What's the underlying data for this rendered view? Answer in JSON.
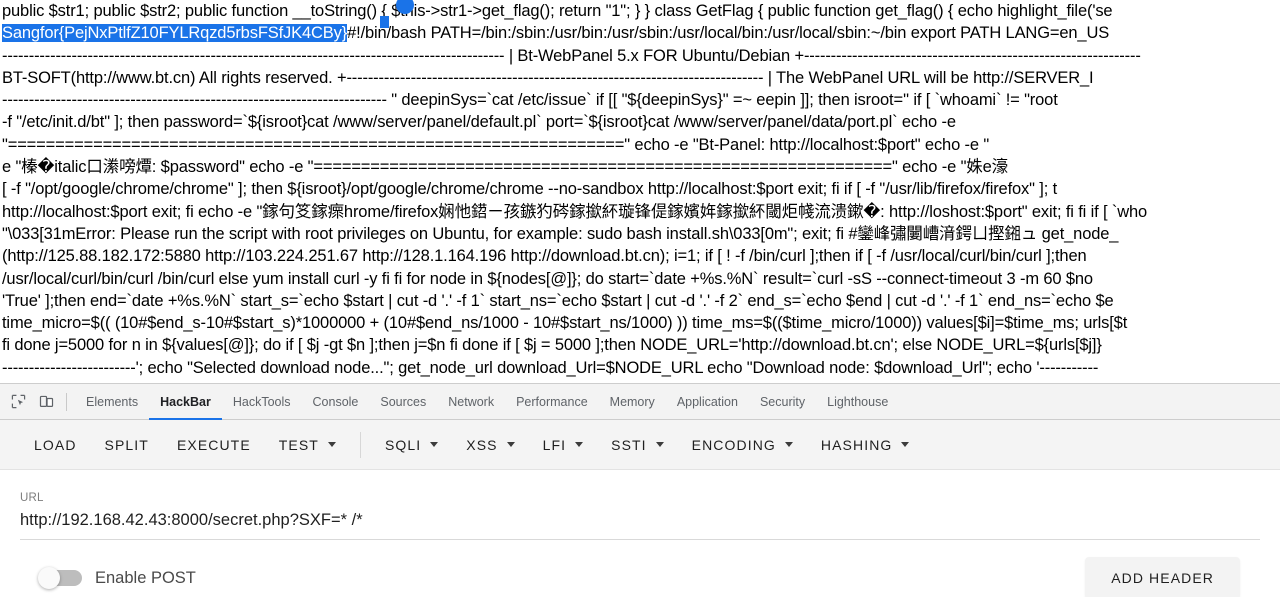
{
  "page": {
    "selected_text": "Sangfor{PejNxPtlfZ10FYLRqzd5rbsFSfJK4CBy}",
    "lines": [
      "public $str1; public $str2; public function __toString() { $this->str1->get_flag(); return \"1\"; } } class GetFlag { public function get_flag() { echo highlight_file('se",
      "#!/bin/bash PATH=/bin:/sbin:/usr/bin:/usr/sbin:/usr/local/bin:/usr/local/sbin:~/bin export PATH LANG=en_US",
      "---------------------------------------------------------------------------------------------- | Bt-WebPanel 5.x FOR Ubuntu/Debian +---------------------------------------------------------------",
      "BT-SOFT(http://www.bt.cn) All rights reserved. +------------------------------------------------------------------------------ | The WebPanel URL will be http://SERVER_I",
      "------------------------------------------------------------------------ \" deepinSys=`cat /etc/issue` if [[ \"${deepinSys}\" =~ eepin ]]; then isroot='' if [ `whoami` != \"root",
      "-f \"/etc/init.d/bt\" ]; then password=`${isroot}cat /www/server/panel/default.pl` port=`${isroot}cat /www/server/panel/data/port.pl` echo -e",
      "\"=================================================================\" echo -e \"Bt-Panel: http://localhost:$port\" echo -e \"",
      "e \"榛�italic口潫嗙燂: $password\" echo -e \"=============================================================\" echo -e \"姝e濠",
      "[ -f \"/opt/google/chrome/chrome\" ]; then ${isroot}/opt/google/chrome/chrome --no-sandbox http://localhost:$port exit; fi if [ -f \"/usr/lib/firefox/firefox\" ]; t",
      "http://localhost:$port exit; fi echo -e \"鎵句笅鎵瘝hrome/firefox娴忚鍣ㄧ孩鏃犳硶鎵撳紑璇锋偍鎵嬪姩鎵撳紑閾炬帴流溃鏉�: http://loshost:$port\" exit; fi fi if [ `who",
      "\"\\033[31mError: Please run the script with root privileges on Ubuntu, for example: sudo bash install.sh\\033[0m\"; exit; fi #鑾峰彇闄嶆湇鍔ㄩ摼鎺ュ get_node_",
      "(http://125.88.182.172:5880 http://103.224.251.67 http://128.1.164.196 http://download.bt.cn); i=1; if [ ! -f /bin/curl ];then if [ -f /usr/local/curl/bin/curl ];then",
      "/usr/local/curl/bin/curl /bin/curl else yum install curl -y fi fi for node in ${nodes[@]}; do start=`date +%s.%N` result=`curl -sS --connect-timeout 3 -m 60 $no",
      "'True' ];then end=`date +%s.%N` start_s=`echo $start | cut -d '.' -f 1` start_ns=`echo $start | cut -d '.' -f 2` end_s=`echo $end | cut -d '.' -f 1` end_ns=`echo $e",
      "time_micro=$(( (10#$end_s-10#$start_s)*1000000 + (10#$end_ns/1000 - 10#$start_ns/1000) )) time_ms=$(($time_micro/1000)) values[$i]=$time_ms; urls[$t",
      "fi done j=5000 for n in ${values[@]}; do if [ $j -gt $n ];then j=$n fi done if [ $j = 5000 ];then NODE_URL='http://download.bt.cn'; else NODE_URL=${urls[$j]}",
      "-------------------------'; echo \"Selected download node...\"; get_node_url download_Url=$NODE_URL echo \"Download node: $download_Url\"; echo '-----------"
    ]
  },
  "devtools": {
    "inspect_icon": "inspect-element-icon",
    "device_icon": "device-toolbar-icon",
    "tabs": [
      {
        "label": "Elements",
        "active": false
      },
      {
        "label": "HackBar",
        "active": true
      },
      {
        "label": "HackTools",
        "active": false
      },
      {
        "label": "Console",
        "active": false
      },
      {
        "label": "Sources",
        "active": false
      },
      {
        "label": "Network",
        "active": false
      },
      {
        "label": "Performance",
        "active": false
      },
      {
        "label": "Memory",
        "active": false
      },
      {
        "label": "Application",
        "active": false
      },
      {
        "label": "Security",
        "active": false
      },
      {
        "label": "Lighthouse",
        "active": false
      }
    ],
    "active_tab_accent": "#1a73e8"
  },
  "hackbar": {
    "toolbar": [
      {
        "label": "LOAD",
        "dropdown": false
      },
      {
        "label": "SPLIT",
        "dropdown": false
      },
      {
        "label": "EXECUTE",
        "dropdown": false
      },
      {
        "label": "TEST",
        "dropdown": true
      },
      {
        "label": "SQLI",
        "dropdown": true
      },
      {
        "label": "XSS",
        "dropdown": true
      },
      {
        "label": "LFI",
        "dropdown": true
      },
      {
        "label": "SSTI",
        "dropdown": true
      },
      {
        "label": "ENCODING",
        "dropdown": true
      },
      {
        "label": "HASHING",
        "dropdown": true
      }
    ],
    "url": {
      "label": "URL",
      "value": "http://192.168.42.43:8000/secret.php?SXF=* /*"
    },
    "enable_post": {
      "label": "Enable POST",
      "checked": false
    },
    "add_header_label": "ADD HEADER"
  }
}
